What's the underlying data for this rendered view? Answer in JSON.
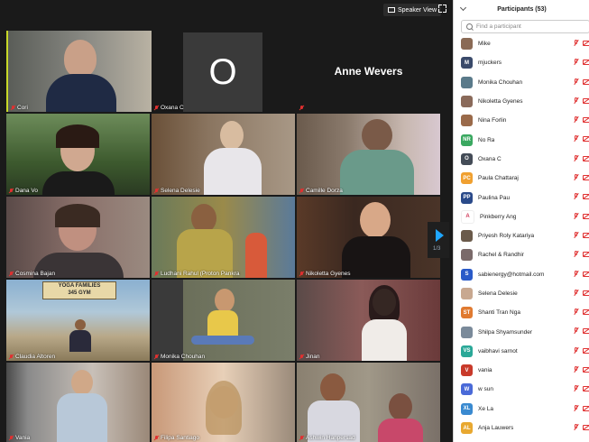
{
  "toolbar": {
    "speaker_view_label": "Speaker View"
  },
  "pager": {
    "label": "1/3"
  },
  "tiles": [
    {
      "name": "Cori",
      "bg": "#6e6e6a"
    },
    {
      "name": "Oxana C",
      "initial": "O",
      "bg": "#1a1a1a"
    },
    {
      "name": "",
      "display_name": "Anne Wevers",
      "bg": "#1a1a1a"
    },
    {
      "name": "Dana Vo",
      "bg": "#3f5a33"
    },
    {
      "name": "Selena Delesie",
      "bg": "#7a6a58"
    },
    {
      "name": "Camille Dorza",
      "bg": "#8a7868"
    },
    {
      "name": "Cosmina Bajan",
      "bg": "#6a5552"
    },
    {
      "name": "Ludhani Rahul (Proton Pankra",
      "bg": "#9a8c4a"
    },
    {
      "name": "Nikoletta Gyenes",
      "bg": "#4a3528"
    },
    {
      "name": "Claudia Altoren",
      "bg": "#7aa0c0",
      "sign": "YOGA FAMILIES\n345 GYM"
    },
    {
      "name": "Monika Chouhan",
      "bg": "#6b6f5a"
    },
    {
      "name": "Jinan",
      "bg": "#5a4a48"
    },
    {
      "name": "Vania",
      "bg": "#6a6f73"
    },
    {
      "name": "Filipa Santiago",
      "bg": "#9a8a7a"
    },
    {
      "name": "Ashwin Hanpersad",
      "bg": "#8a8070"
    }
  ],
  "participants_panel": {
    "title": "Participants (53)",
    "search_placeholder": "Find a participant",
    "participants": [
      {
        "name": "Mike",
        "avatar": "",
        "color": "#8a6a55"
      },
      {
        "name": "mjuckers",
        "avatar": "M",
        "color": "#3a4a6a"
      },
      {
        "name": "Monika Chouhan",
        "avatar": "",
        "color": "#5a7a8a"
      },
      {
        "name": "Nikoletta Gyenes",
        "avatar": "",
        "color": "#8a6a5a"
      },
      {
        "name": "Nina Forlin",
        "avatar": "",
        "color": "#9a6a4a"
      },
      {
        "name": "No Ra",
        "avatar": "NR",
        "color": "#3aa860"
      },
      {
        "name": "Oxana C",
        "avatar": "O",
        "color": "#444c57"
      },
      {
        "name": "Paula Chattaraj",
        "avatar": "PC",
        "color": "#f0a030"
      },
      {
        "name": "Paulina Pau",
        "avatar": "PP",
        "color": "#2a4a8a"
      },
      {
        "name": "Pinkberry Ang",
        "avatar": "A",
        "color": "#ffffff"
      },
      {
        "name": "Priyesh Roly Katariya",
        "avatar": "",
        "color": "#6a5a4a"
      },
      {
        "name": "Rachel & Randhir",
        "avatar": "",
        "color": "#7a6a6a"
      },
      {
        "name": "sabienergy@hotmail.com",
        "avatar": "S",
        "color": "#2a5ac8"
      },
      {
        "name": "Selena Delesie",
        "avatar": "",
        "color": "#c8a890"
      },
      {
        "name": "Shanti Tran Nga",
        "avatar": "ST",
        "color": "#e07a30"
      },
      {
        "name": "Shilpa Shyamsunder",
        "avatar": "",
        "color": "#7a8a9a"
      },
      {
        "name": "vaibhavi sarnot",
        "avatar": "VS",
        "color": "#2aa898"
      },
      {
        "name": "vania",
        "avatar": "V",
        "color": "#c83a2a"
      },
      {
        "name": "w sun",
        "avatar": "W",
        "color": "#4a6ad8"
      },
      {
        "name": "Xe La",
        "avatar": "XL",
        "color": "#3a8ad0"
      },
      {
        "name": "Anja Lauwers",
        "avatar": "AL",
        "color": "#e8a830"
      }
    ]
  }
}
